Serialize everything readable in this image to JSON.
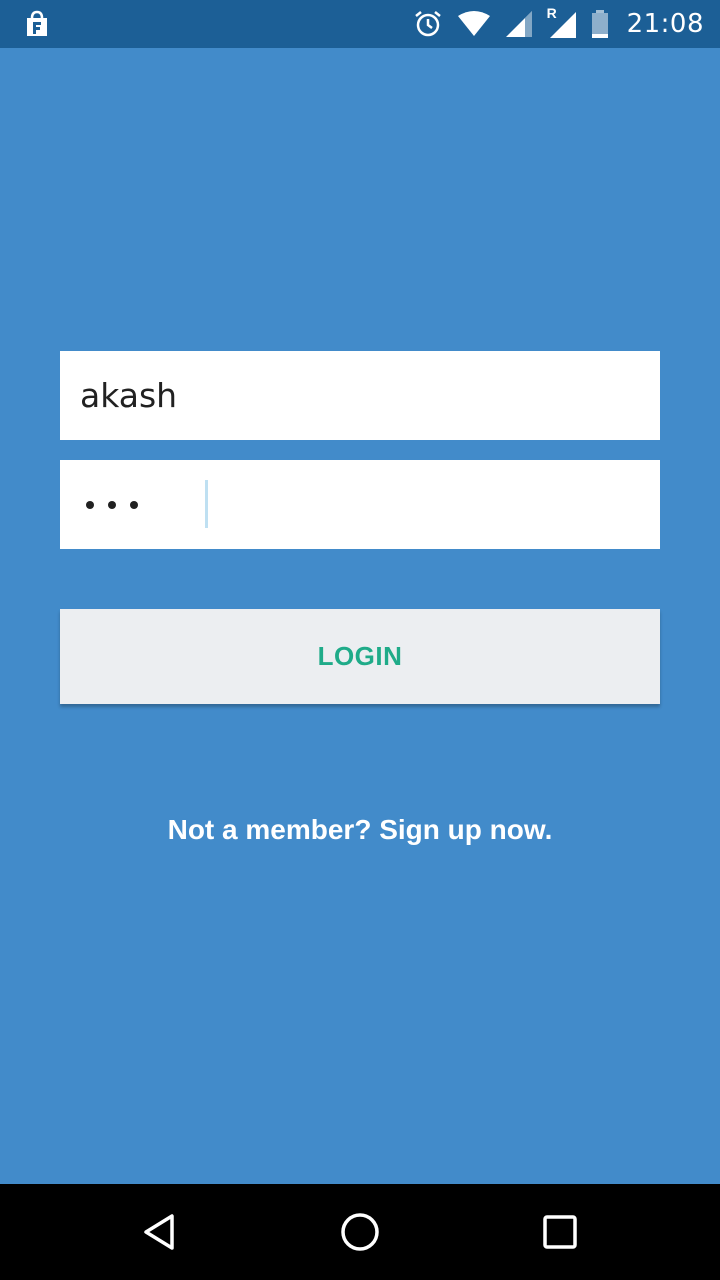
{
  "status_bar": {
    "time": "21:08",
    "icons": [
      "shopping-bag-notification-icon",
      "alarm-icon",
      "wifi-icon",
      "signal-icon",
      "roaming-signal-icon",
      "battery-icon"
    ],
    "roaming_label": "R"
  },
  "login_form": {
    "username_value": "akash",
    "password_length": 3,
    "login_label": "LOGIN",
    "signup_text": "Not a member? Sign up now."
  },
  "nav_bar": {
    "icons": [
      "back-icon",
      "home-icon",
      "recents-icon"
    ]
  },
  "colors": {
    "background": "#428bca",
    "status_bar": "#1c5f96",
    "button_bg": "#eceef1",
    "button_text": "#1fab89",
    "text_white": "#ffffff"
  }
}
